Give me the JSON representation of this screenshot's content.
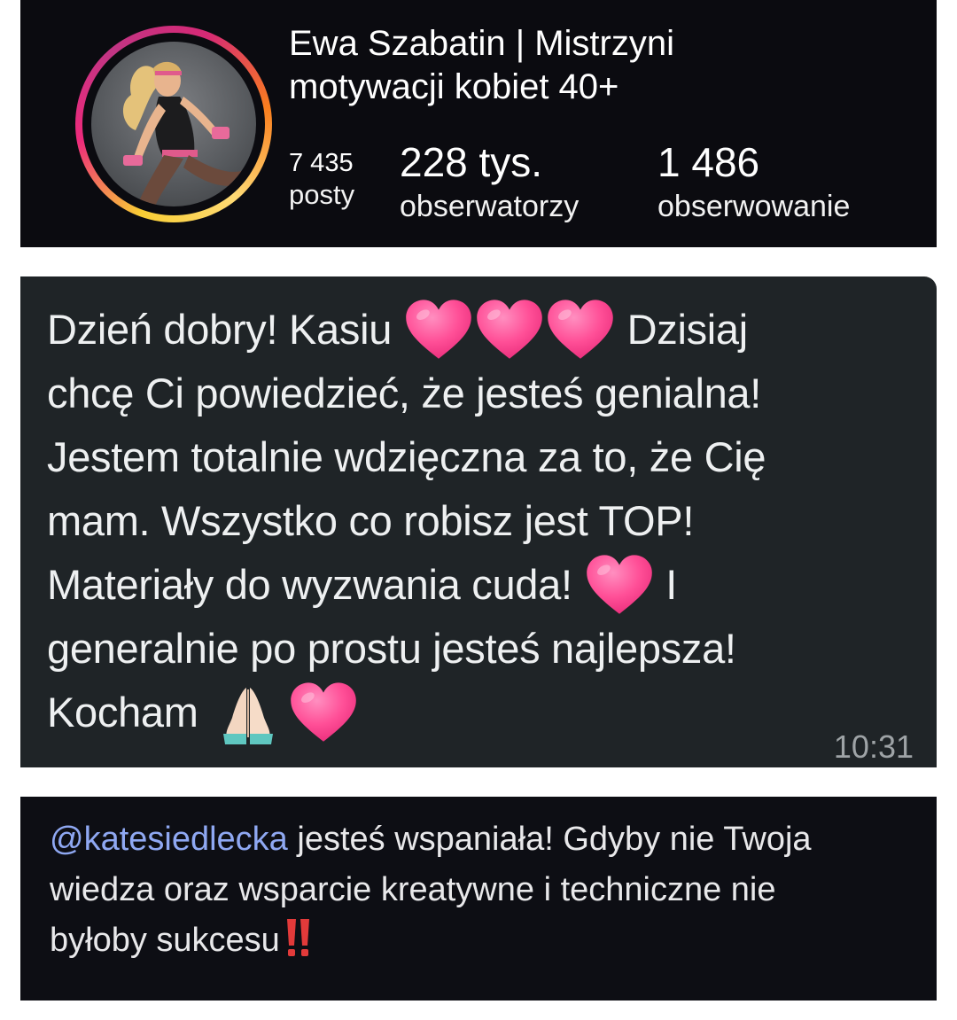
{
  "profile": {
    "name_line1": "Ewa Szabatin | Mistrzyni",
    "name_line2": "motywacji kobiet 40+",
    "stats": {
      "posts_value": "7 435",
      "posts_label": "posty",
      "followers_value": "228 tys.",
      "followers_label": "obserwatorzy",
      "following_value": "1 486",
      "following_label": "obserwowanie"
    },
    "ring_colors": [
      "#f9ce34",
      "#ee2a7b",
      "#c13584",
      "#fa7e1e"
    ]
  },
  "message": {
    "line1_before": "Dzień dobry! Kasiu",
    "line1_after": "Dzisiaj",
    "line2": "chcę Ci powiedzieć, że jesteś genialna!",
    "line3": "Jestem totalnie wdzięczna za to, że Cię",
    "line4": "mam. Wszystko co robisz jest TOP!",
    "line5_before": "Materiały do wyzwania cuda!",
    "line5_after": "I",
    "line6": "generalnie po prostu jesteś najlepsza!",
    "line7": "Kocham",
    "time": "10:31",
    "emoji_names": [
      "heart-emoji",
      "folded-hands-emoji"
    ]
  },
  "comment": {
    "mention": "@katesiedlecka",
    "text_line1_rest": " jesteś wspaniała! Gdyby nie Twoja",
    "text_line2": "wiedza oraz wsparcie kreatywne i techniczne nie",
    "text_line3": "byłoby sukcesu",
    "mention_color": "#8fa8f2",
    "emoji_name": "double-exclamation-emoji"
  }
}
